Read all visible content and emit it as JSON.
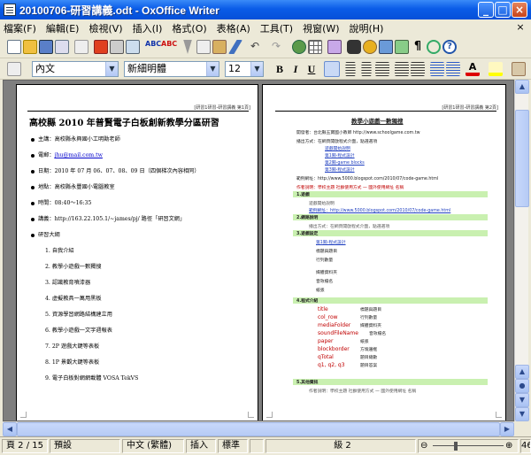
{
  "window": {
    "title": "20100706-研習講義.odt - OxOffice Writer",
    "minimize": "_",
    "maximize": "□",
    "close": "×"
  },
  "menu": [
    "檔案(F)",
    "編輯(E)",
    "檢視(V)",
    "插入(I)",
    "格式(O)",
    "表格(A)",
    "工具(T)",
    "視窗(W)",
    "說明(H)"
  ],
  "menu_close": "×",
  "format_bar": {
    "style": "內文",
    "font": "新細明體",
    "size": "12",
    "bold": "B",
    "italic": "I",
    "underline": "U"
  },
  "page1": {
    "header": "[研習1研習-研習講義 第1頁]",
    "title": "高校縣 2010 年普賢電子白板創新教學分區研習",
    "lines": [
      {
        "label": "主講：",
        "text": "高校縣永興國小工明勳老師"
      },
      {
        "label": "電郵：",
        "text": "jhu@mail.com.tw"
      },
      {
        "label": "日期：",
        "text": "2010 年 07 月 06、07、08、09 日（四個梯次內容相同）"
      },
      {
        "label": "地點：",
        "text": "高校縣永豐國小電腦教室"
      },
      {
        "label": "時間：",
        "text": "08:40～16:35"
      },
      {
        "label": "講義：",
        "text": "http://163.22.105.1/~james/pj/ 路徑「研習文網」"
      },
      {
        "label": "",
        "text": "研習大綱"
      }
    ],
    "outline": [
      "1. 自我介紹",
      "2. 教學小遊戲一數獨搜",
      "3. 認識教育噴漆器",
      "4. 虛擬教具一萬用黑板",
      "5. 資源學習網路結構建立用",
      "6. 教學小遊戲一文字週報表",
      "7. 2P 遊戲大鍵等表板",
      "8. 1P 景觀大鍵等表板",
      "9. 電子白板對網網載體 VOSA TekVS"
    ]
  },
  "page2": {
    "header": "[研習1研習-研習講義 第2頁]",
    "title": "教學小遊戲一數獨搜",
    "l1": "開發者：台北縣五寶國小教師 http://www.schoolgame.com.tw",
    "l2": "播出方式：在網頁開啟程式介面，點選選項",
    "links": [
      "遊戲開始說明",
      "第1關-程式設計",
      "第2關-game blocks",
      "第3關-程式設計"
    ],
    "l3": "範例網址：http://www.5000.blogspot.com/2010/07/code-game.html",
    "l4": "作者說明：學校主題 社群使用方式 一 國外使用網址 名稱",
    "sections": [
      "1.遊戲",
      "2.網路說明",
      "3.遊戲設定",
      "4.程式介紹",
      "5.其他資訊"
    ],
    "red_items": [
      "title",
      "col_row",
      "mediaFolder",
      "soundFileName",
      "paper",
      "blockborder",
      "qTotal",
      "q1, q2, q3"
    ],
    "item_desc": [
      "標題與題目",
      "行列數量",
      "媒體資料夾",
      "音效檔名",
      "紙張",
      "方塊邊框",
      "題目總數",
      "題目答案"
    ]
  },
  "status": {
    "page": "頁 2 / 15",
    "style": "預設",
    "lang": "中文 (繁體)",
    "insert": "插入",
    "mode": "標準",
    "level": "級 2",
    "zoom": "46%"
  }
}
